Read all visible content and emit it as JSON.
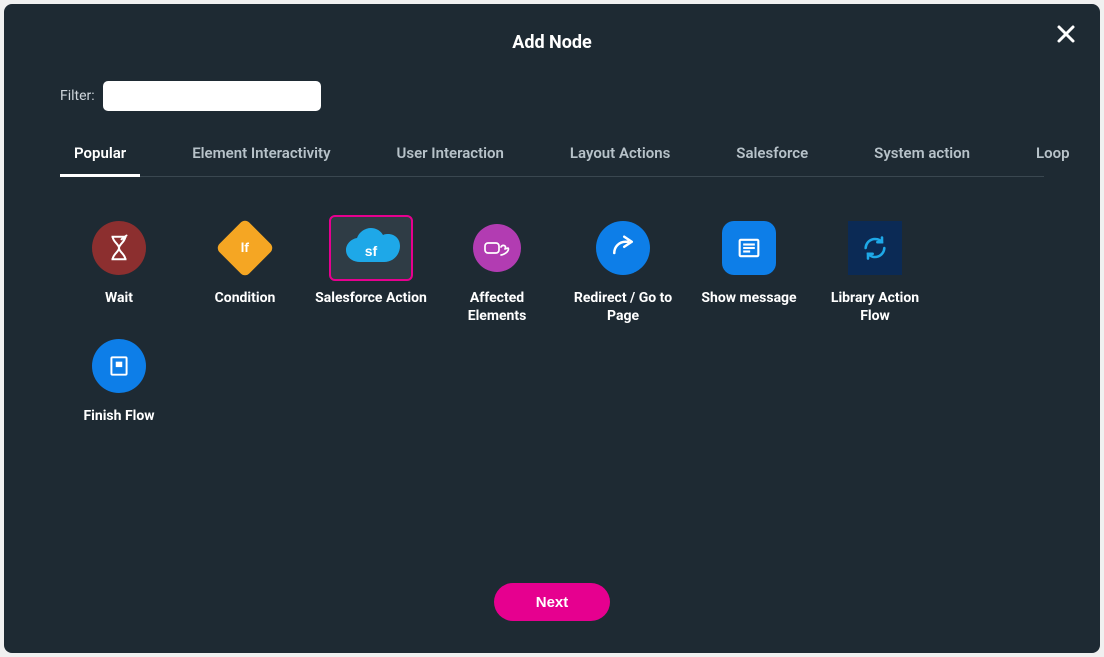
{
  "modal": {
    "title": "Add Node",
    "close_label": "Close"
  },
  "filter": {
    "label": "Filter:",
    "value": ""
  },
  "tabs": [
    {
      "label": "Popular",
      "active": true
    },
    {
      "label": "Element Interactivity",
      "active": false
    },
    {
      "label": "User Interaction",
      "active": false
    },
    {
      "label": "Layout Actions",
      "active": false
    },
    {
      "label": "Salesforce",
      "active": false
    },
    {
      "label": "System action",
      "active": false
    },
    {
      "label": "Loop",
      "active": false
    }
  ],
  "nodes": [
    {
      "label": "Wait",
      "icon": "hourglass-icon",
      "shape": "circle",
      "color": "#8c2f2f",
      "selected": false
    },
    {
      "label": "Condition",
      "icon": "condition-icon",
      "shape": "diamond",
      "color": "#f5a623",
      "selected": false,
      "text": "If"
    },
    {
      "label": "Salesforce Action",
      "icon": "cloud-sf-icon",
      "shape": "plain",
      "color": "#1ea8e8",
      "selected": true,
      "text": "sf"
    },
    {
      "label": "Affected Elements",
      "icon": "hand-click-icon",
      "shape": "circle",
      "color": "#b23cb2",
      "selected": false
    },
    {
      "label": "Redirect / Go to Page",
      "icon": "redirect-icon",
      "shape": "circle",
      "color": "#0d7ee8",
      "selected": false
    },
    {
      "label": "Show message",
      "icon": "message-icon",
      "shape": "rsquare",
      "color": "#0d7ee8",
      "selected": false
    },
    {
      "label": "Library Action Flow",
      "icon": "refresh-icon",
      "shape": "square",
      "color": "#0b2a55",
      "selected": false
    },
    {
      "label": "Finish Flow",
      "icon": "finish-icon",
      "shape": "circle",
      "color": "#0d7ee8",
      "selected": false
    }
  ],
  "footer": {
    "next_label": "Next"
  }
}
